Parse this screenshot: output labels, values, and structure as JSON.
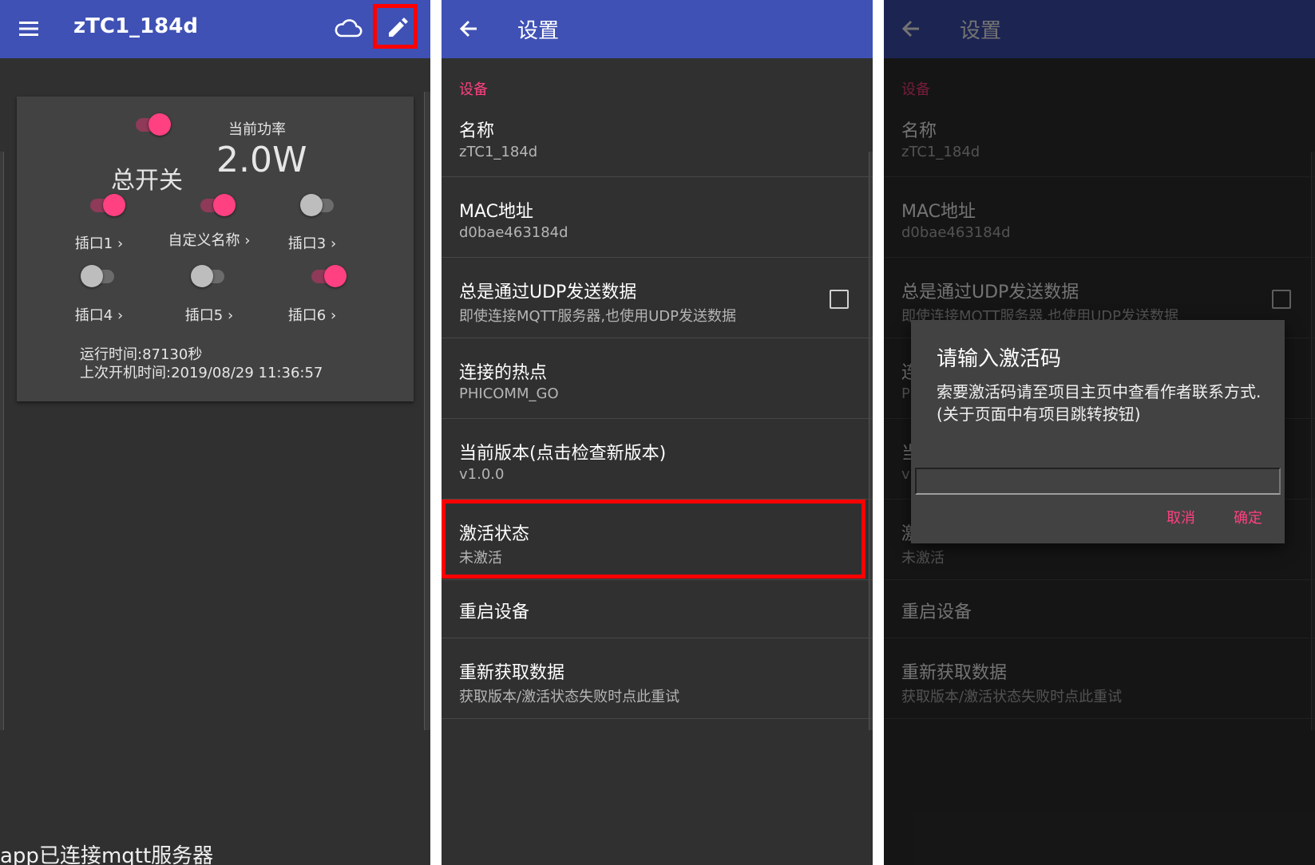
{
  "colors": {
    "primary": "#3f51b5",
    "accent": "#ff4081",
    "background": "#303030",
    "card": "#424242",
    "highlight": "#ff0000"
  },
  "main_screen": {
    "title": "zTC1_184d",
    "menu_icon": "menu-icon",
    "cloud_icon": "cloud-icon",
    "edit_icon": "pencil-icon",
    "master_switch": {
      "label": "总开关",
      "on": true
    },
    "power": {
      "label": "当前功率",
      "value": "2.0W"
    },
    "ports": [
      {
        "label": "插口1",
        "chevron": "›",
        "on": true
      },
      {
        "label": "自定义名称",
        "chevron": "›",
        "on": true
      },
      {
        "label": "插口3",
        "chevron": "›",
        "on": false
      },
      {
        "label": "插口4",
        "chevron": "›",
        "on": false
      },
      {
        "label": "插口5",
        "chevron": "›",
        "on": false
      },
      {
        "label": "插口6",
        "chevron": "›",
        "on": true
      }
    ],
    "runtime": "运行时间:87130秒",
    "last_boot": "上次开机时间:2019/08/29 11:36:57",
    "status": "app已连接mqtt服务器"
  },
  "settings": {
    "title": "设置",
    "back_icon": "arrow-back-icon",
    "section": "设备",
    "items": [
      {
        "title": "名称",
        "summary": "zTC1_184d"
      },
      {
        "title": "MAC地址",
        "summary": "d0bae463184d"
      },
      {
        "title": "总是通过UDP发送数据",
        "summary": "即使连接MQTT服务器,也使用UDP发送数据",
        "checked": false
      },
      {
        "title": "连接的热点",
        "summary": "PHICOMM_GO"
      },
      {
        "title": "当前版本(点击检查新版本)",
        "summary": "v1.0.0"
      },
      {
        "title": "激活状态",
        "summary": "未激活"
      },
      {
        "title": "重启设备",
        "summary": ""
      },
      {
        "title": "重新获取数据",
        "summary": "获取版本/激活状态失败时点此重试"
      }
    ]
  },
  "dialog": {
    "title": "请输入激活码",
    "message": "索要激活码请至项目主页中查看作者联系方式.(关于页面中有项目跳转按钮)",
    "input_value": "",
    "cancel": "取消",
    "confirm": "确定"
  }
}
